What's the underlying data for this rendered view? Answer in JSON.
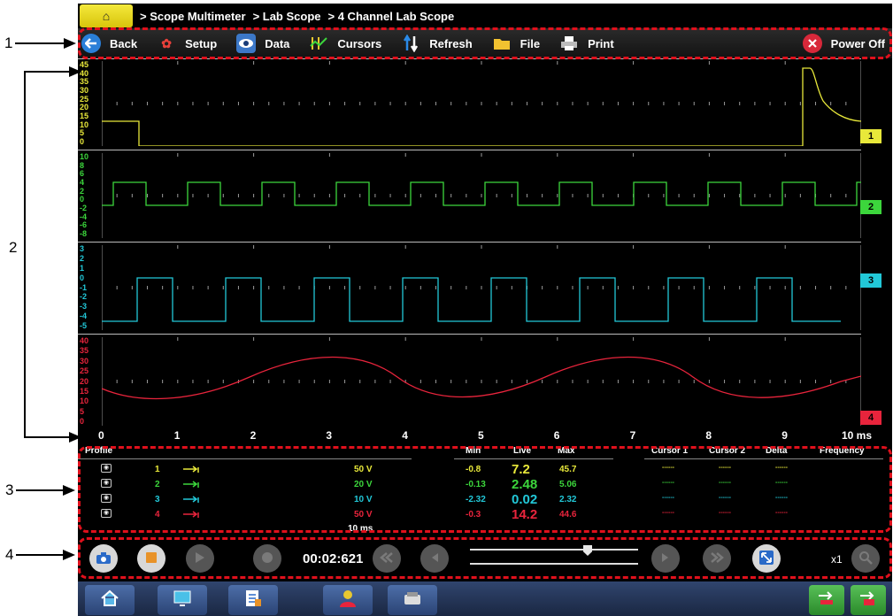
{
  "callouts": [
    "1",
    "2",
    "3",
    "4"
  ],
  "breadcrumb": {
    "home_glyph": "⌂",
    "items": [
      "> Scope Multimeter",
      "> Lab Scope",
      "> 4 Channel Lab Scope"
    ]
  },
  "toolbar": {
    "back": "Back",
    "setup": "Setup",
    "data": "Data",
    "cursors": "Cursors",
    "refresh": "Refresh",
    "file": "File",
    "print": "Print",
    "power_off": "Power Off"
  },
  "colors": {
    "ch1": "#e8e83a",
    "ch2": "#3cd63c",
    "ch3": "#22c8d8",
    "ch4": "#e8243c",
    "callout_box": "#e0101c"
  },
  "channels": [
    {
      "tag": "1",
      "scale": [
        "45",
        "40",
        "35",
        "30",
        "25",
        "20",
        "15",
        "10",
        "5",
        "0"
      ],
      "profile": "1",
      "scale_value": "50 V",
      "min": "-0.8",
      "live": "7.2",
      "max": "45.7",
      "cursor1": "------",
      "cursor2": "------",
      "delta": "------"
    },
    {
      "tag": "2",
      "scale": [
        "10",
        "8",
        "6",
        "4",
        "2",
        "0",
        "-2",
        "-4",
        "-6",
        "-8"
      ],
      "profile": "2",
      "scale_value": "20 V",
      "min": "-0.13",
      "live": "2.48",
      "max": "5.06",
      "cursor1": "------",
      "cursor2": "------",
      "delta": "------"
    },
    {
      "tag": "3",
      "scale": [
        "3",
        "2",
        "1",
        "0",
        "-1",
        "-2",
        "-3",
        "-4",
        "-5"
      ],
      "profile": "3",
      "scale_value": "10 V",
      "min": "-2.32",
      "live": "0.02",
      "max": "2.32",
      "cursor1": "------",
      "cursor2": "------",
      "delta": "------"
    },
    {
      "tag": "4",
      "scale": [
        "40",
        "35",
        "30",
        "25",
        "20",
        "15",
        "10",
        "5",
        "0"
      ],
      "profile": "4",
      "scale_value": "50 V",
      "min": "-0.3",
      "live": "14.2",
      "max": "44.6",
      "cursor1": "------",
      "cursor2": "------",
      "delta": "------"
    }
  ],
  "time_axis": [
    "0",
    "1",
    "2",
    "3",
    "4",
    "5",
    "6",
    "7",
    "8",
    "9",
    "10 ms"
  ],
  "table": {
    "headers": {
      "profile": "Profile",
      "min": "Min",
      "live": "Live",
      "max": "Max",
      "cursor1": "Cursor 1",
      "cursor2": "Cursor 2",
      "delta": "Delta",
      "frequency": "Frequency"
    },
    "timebase": "10 ms"
  },
  "playback": {
    "timer": "00:02:621",
    "zoom": "x1",
    "slider_position": 0.7
  },
  "icons": {
    "toolbar": [
      "back-arrow-icon",
      "gear-icon",
      "eye-icon",
      "cursors-icon",
      "refresh-icon",
      "folder-icon",
      "printer-icon",
      "power-off-icon"
    ],
    "playback": [
      "camera-icon",
      "stop-icon",
      "play-icon",
      "record-icon",
      "skip-back-icon",
      "step-back-icon",
      "step-forward-icon",
      "skip-forward-icon",
      "fit-screen-icon",
      "zoom-icon"
    ],
    "taskbar": [
      "home-icon",
      "monitor-icon",
      "checklist-icon",
      "mechanic-icon",
      "scanner-icon",
      "connection-icon",
      "vci-icon"
    ]
  }
}
